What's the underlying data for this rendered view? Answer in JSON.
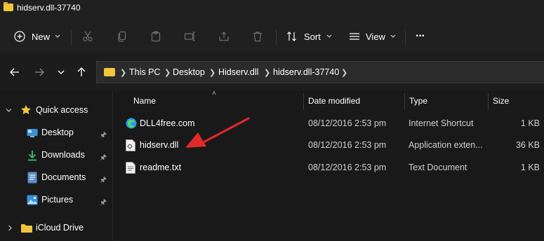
{
  "window": {
    "title": "hidserv.dll-37740"
  },
  "toolbar": {
    "new_label": "New",
    "sort_label": "Sort",
    "view_label": "View",
    "more_label": "···"
  },
  "address": {
    "crumbs": [
      "This PC",
      "Desktop",
      "Hidserv.dll",
      "hidserv.dll-37740"
    ]
  },
  "sidebar": {
    "items": [
      {
        "label": "Quick access"
      },
      {
        "label": "Desktop"
      },
      {
        "label": "Downloads"
      },
      {
        "label": "Documents"
      },
      {
        "label": "Pictures"
      },
      {
        "label": "iCloud Drive"
      }
    ]
  },
  "columns": {
    "name": "Name",
    "date": "Date modified",
    "type": "Type",
    "size": "Size"
  },
  "files": [
    {
      "name": "DLL4free.com",
      "date": "08/12/2016 2:53 pm",
      "type": "Internet Shortcut",
      "size": "1 KB"
    },
    {
      "name": "hidserv.dll",
      "date": "08/12/2016 2:53 pm",
      "type": "Application exten...",
      "size": "36 KB"
    },
    {
      "name": "readme.txt",
      "date": "08/12/2016 2:53 pm",
      "type": "Text Document",
      "size": "1 KB"
    }
  ],
  "colors": {
    "accent_arrow": "#e02a2a",
    "folder": "#f3c53a",
    "background": "#191919"
  }
}
